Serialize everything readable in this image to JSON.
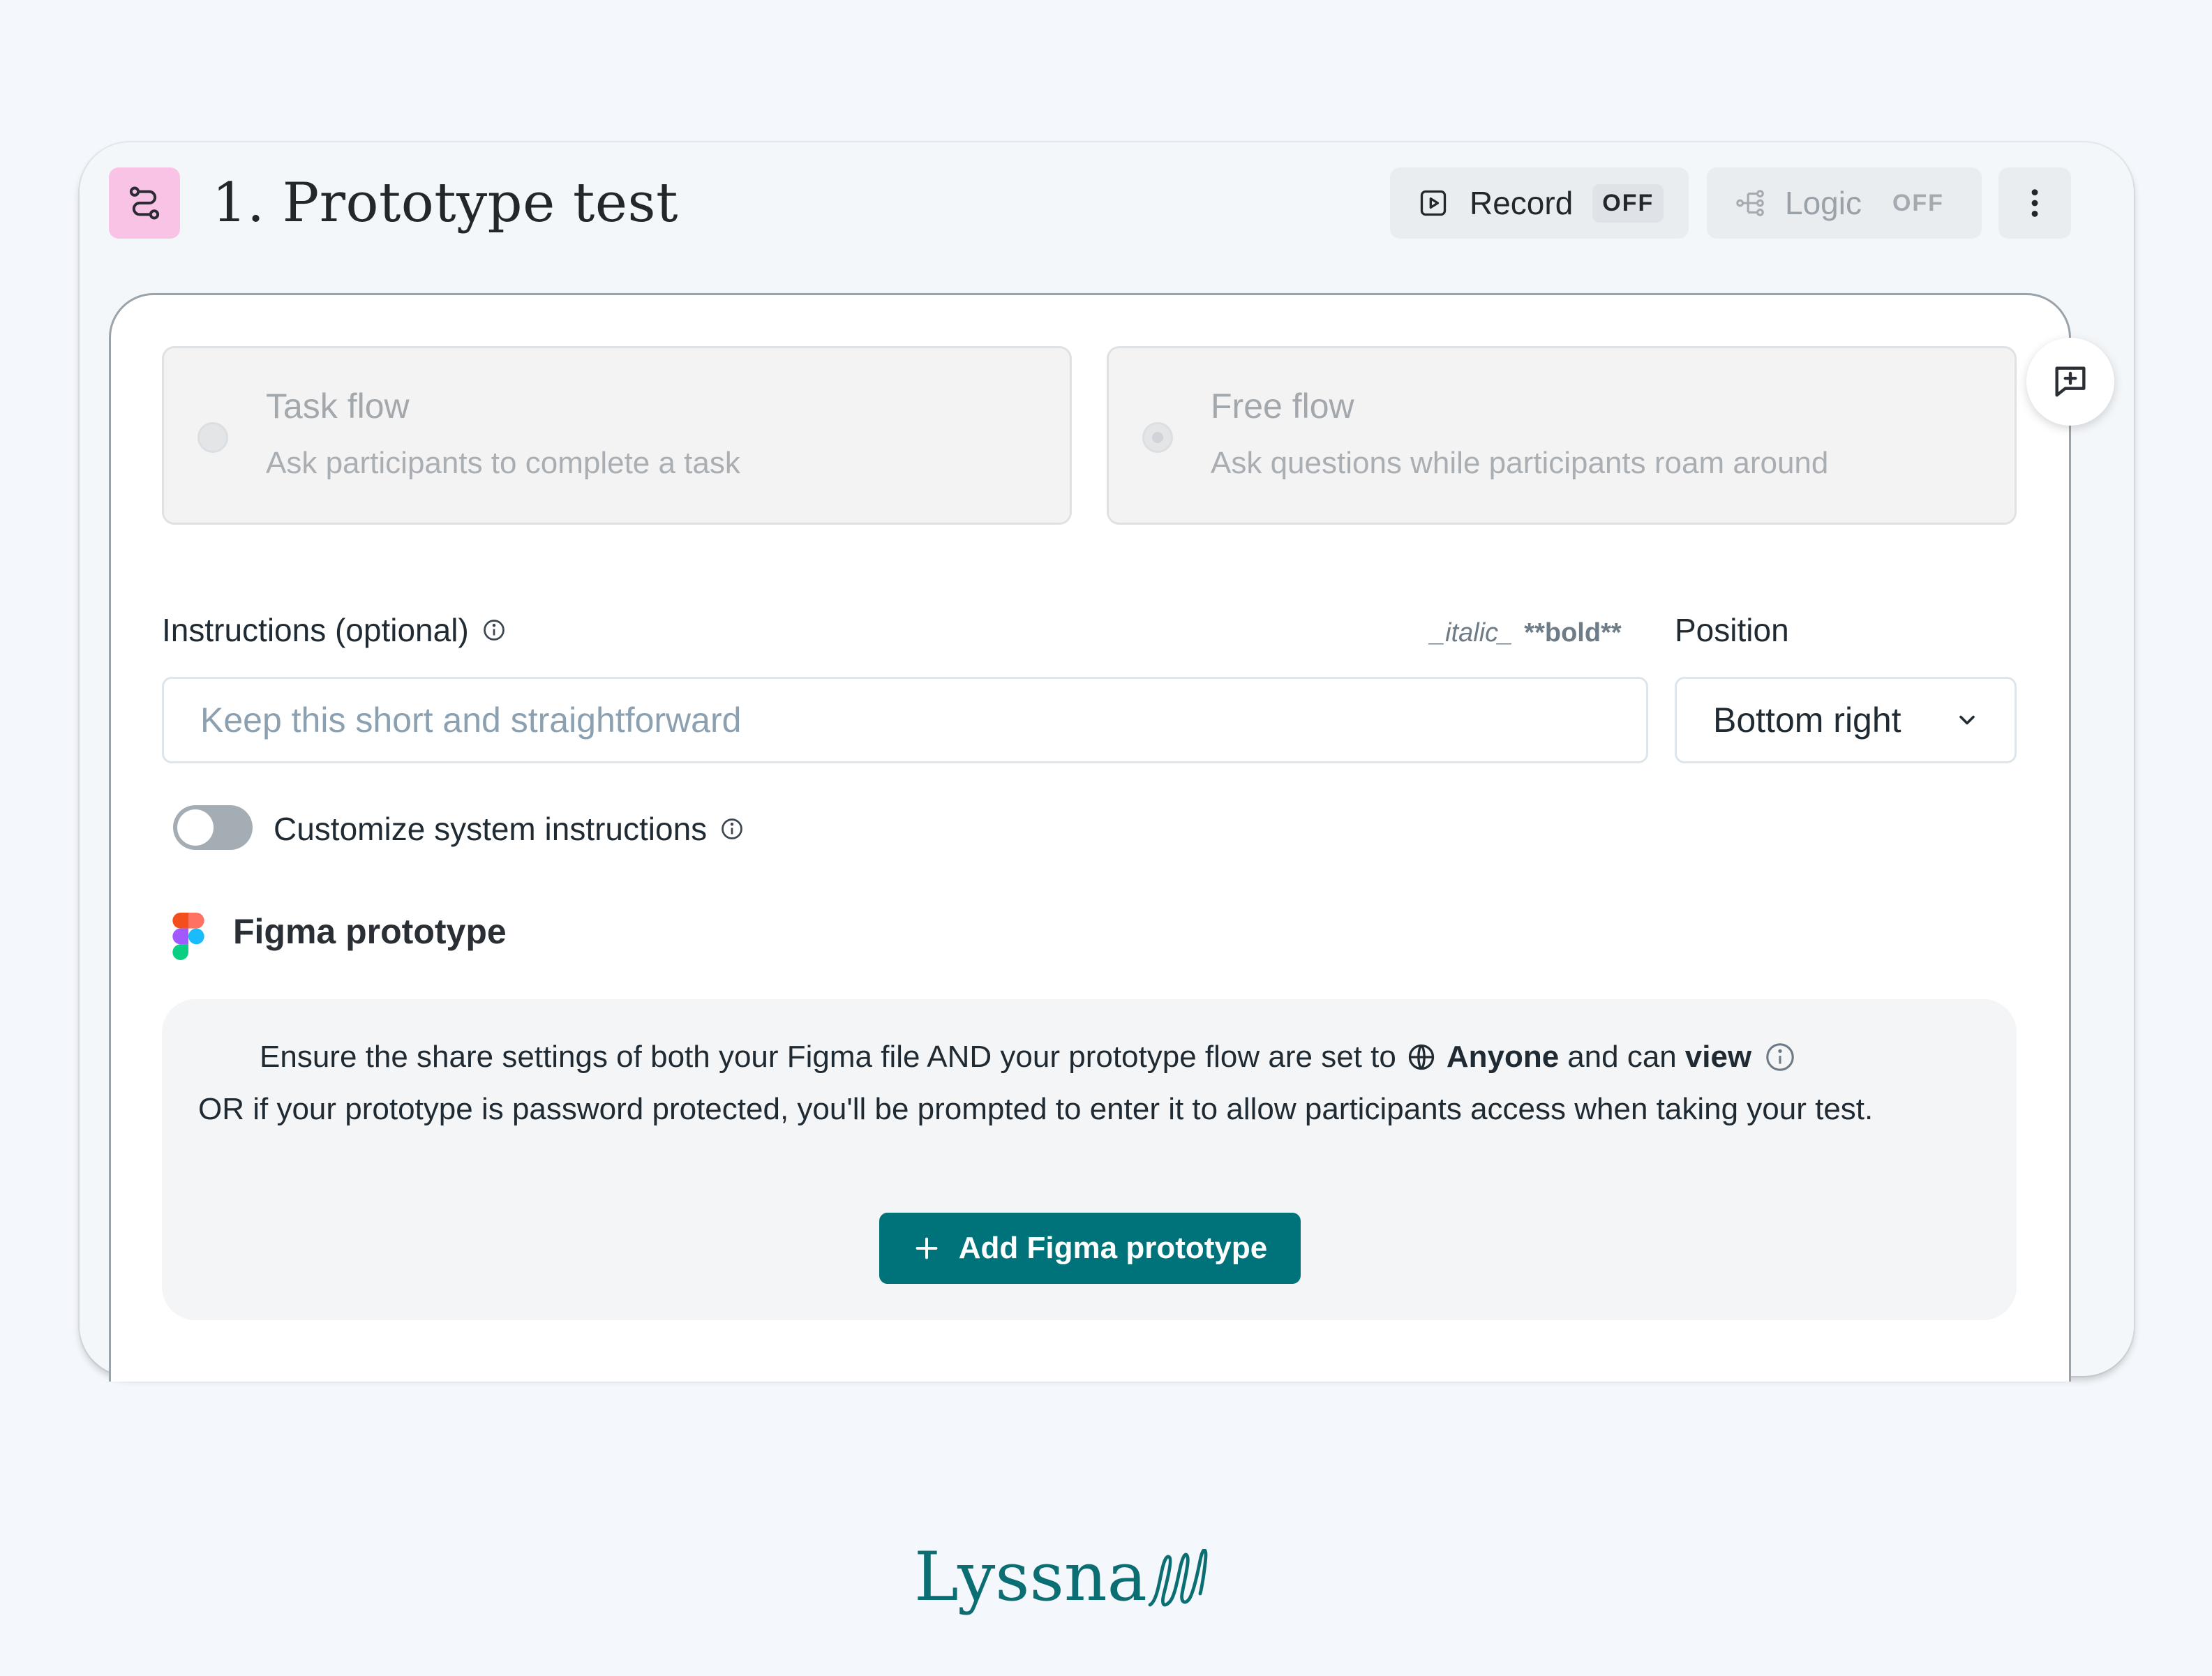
{
  "header": {
    "title": "1. Prototype test",
    "record": {
      "label": "Record",
      "state": "OFF"
    },
    "logic": {
      "label": "Logic",
      "state": "OFF"
    }
  },
  "flows": [
    {
      "title": "Task flow",
      "subtitle": "Ask participants to complete a task"
    },
    {
      "title": "Free flow",
      "subtitle": "Ask questions while participants roam around"
    }
  ],
  "instructions": {
    "label": "Instructions (optional)",
    "markdown_italic": "_italic_",
    "markdown_bold": "**bold**",
    "placeholder": "Keep this short and straightforward"
  },
  "position": {
    "label": "Position",
    "value": "Bottom right"
  },
  "system_instructions": {
    "label": "Customize system instructions",
    "enabled": false
  },
  "figma": {
    "title": "Figma prototype",
    "notice_pre": "Ensure the share settings of both your Figma file AND your prototype flow are set to",
    "notice_anyone": "Anyone",
    "notice_mid": "and can",
    "notice_view": "view",
    "notice_line2": "OR if your prototype is password protected, you'll be prompted to enter it to allow participants access when taking your test.",
    "add_button": "Add Figma prototype"
  },
  "brand": {
    "name": "Lyssna"
  },
  "colors": {
    "accent": "#00737a",
    "header_icon_bg": "#f9c3e6",
    "brand": "#0b6e73"
  }
}
